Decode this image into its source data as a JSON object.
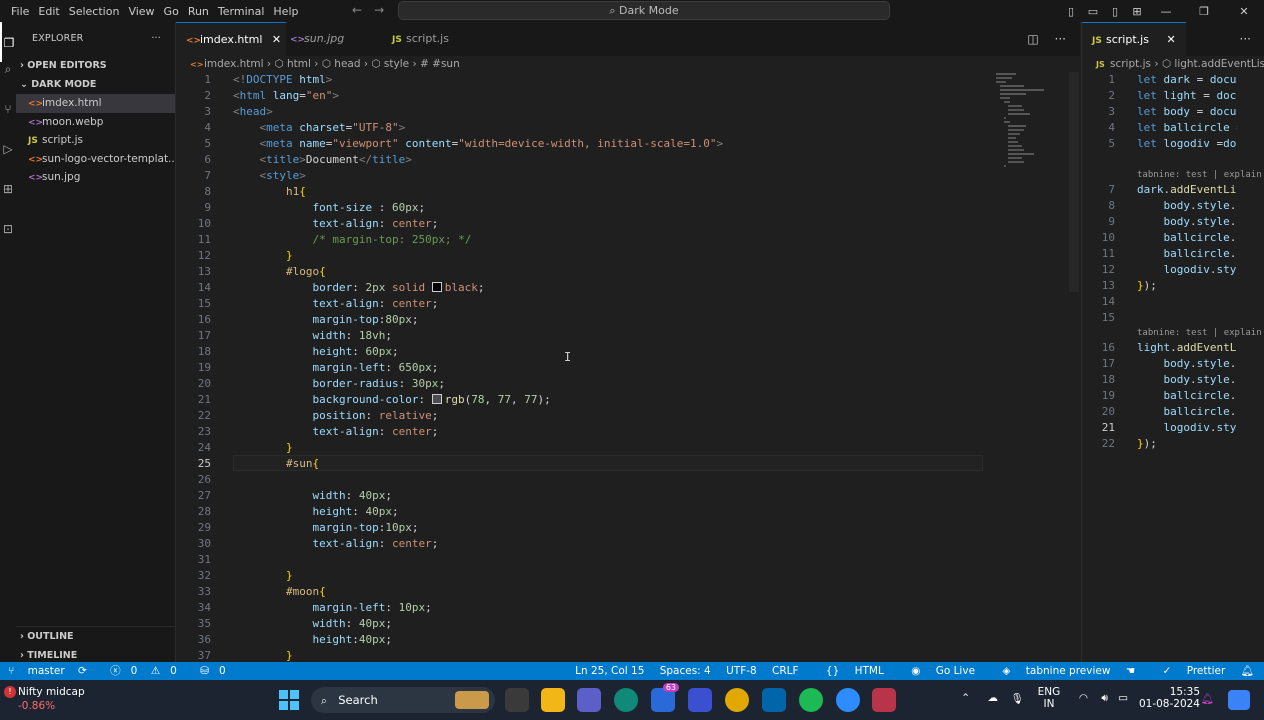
{
  "titlebar": {
    "menu": [
      "File",
      "Edit",
      "Selection",
      "View",
      "Go",
      "Run",
      "Terminal",
      "Help"
    ],
    "search_label": "Dark Mode"
  },
  "sidebar": {
    "title": "EXPLORER",
    "open_editors": "OPEN EDITORS",
    "folder": "DARK MODE",
    "files": [
      {
        "name": "imdex.html",
        "type": "html",
        "icon": "<>"
      },
      {
        "name": "moon.webp",
        "type": "img",
        "icon": "<>"
      },
      {
        "name": "script.js",
        "type": "js",
        "icon": "JS"
      },
      {
        "name": "sun-logo-vector-templat...",
        "type": "html",
        "icon": "<>"
      },
      {
        "name": "sun.jpg",
        "type": "img",
        "icon": "<>"
      }
    ],
    "outline": "OUTLINE",
    "timeline": "TIMELINE"
  },
  "tabs": [
    {
      "label": "imdex.html",
      "icon": "<>"
    },
    {
      "label": "sun.jpg",
      "icon": "<>"
    },
    {
      "label": "script.js",
      "icon": "JS"
    }
  ],
  "breadcrumb": [
    "imdex.html",
    "html",
    "head",
    "style",
    "#sun"
  ],
  "split": {
    "tab": "script.js",
    "tab_icon": "JS",
    "crumb1": "script.js",
    "crumb2": "light.addEventListe",
    "lens": "tabnine: test | explain |"
  },
  "status": {
    "branch": "master",
    "errors": "0",
    "warnings": "0",
    "ports": "0",
    "position": "Ln 25, Col 15",
    "spaces": "Spaces: 4",
    "encoding": "UTF-8",
    "eol": "CRLF",
    "language": "HTML",
    "golive": "Go Live",
    "tabnine": "tabnine preview",
    "prettier": "Prettier"
  },
  "taskbar": {
    "weather_title": "Nifty midcap",
    "weather_value": "-0.86%",
    "search": "Search",
    "badge": "63",
    "lang": "ENG",
    "region": "IN",
    "time": "15:35",
    "date": "01-08-2024"
  },
  "colors": {
    "accent": "#007acc",
    "status": "#007acc",
    "tab_border": "#0078d4"
  }
}
